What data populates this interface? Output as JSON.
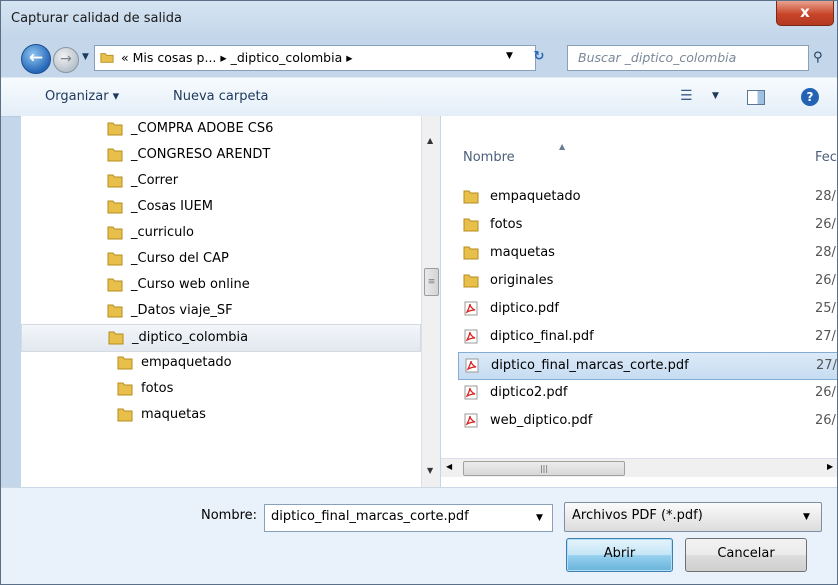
{
  "window": {
    "title": "Capturar calidad de salida",
    "close_symbol": "x"
  },
  "address": {
    "path": "« Mis cosas p... ▸ _diptico_colombia ▸",
    "search_placeholder": "Buscar _diptico_colombia"
  },
  "toolbar": {
    "organize_label": "Organizar ▾",
    "new_folder_label": "Nueva carpeta"
  },
  "nav_tree": [
    {
      "label": "_COMPRA ADOBE CS6"
    },
    {
      "label": "_CONGRESO ARENDT"
    },
    {
      "label": "_Correr"
    },
    {
      "label": "_Cosas IUEM"
    },
    {
      "label": "_curriculo"
    },
    {
      "label": "_Curso del CAP"
    },
    {
      "label": "_Curso web online"
    },
    {
      "label": "_Datos viaje_SF"
    },
    {
      "label": "_diptico_colombia",
      "selected": true
    },
    {
      "label": "empaquetado",
      "indent": true
    },
    {
      "label": "fotos",
      "indent": true
    },
    {
      "label": "maquetas",
      "indent": true
    }
  ],
  "file_list": {
    "columns": {
      "name": "Nombre",
      "date": "Fec"
    },
    "items": [
      {
        "name": "empaquetado",
        "type": "folder",
        "date": "28/"
      },
      {
        "name": "fotos",
        "type": "folder",
        "date": "26/"
      },
      {
        "name": "maquetas",
        "type": "folder",
        "date": "28/"
      },
      {
        "name": "originales",
        "type": "folder",
        "date": "26/"
      },
      {
        "name": "diptico.pdf",
        "type": "pdf",
        "date": "25/"
      },
      {
        "name": "diptico_final.pdf",
        "type": "pdf",
        "date": "27/"
      },
      {
        "name": "diptico_final_marcas_corte.pdf",
        "type": "pdf",
        "date": "27/",
        "selected": true
      },
      {
        "name": "diptico2.pdf",
        "type": "pdf",
        "date": "26/"
      },
      {
        "name": "web_diptico.pdf",
        "type": "pdf",
        "date": "26/"
      }
    ]
  },
  "footer": {
    "name_label": "Nombre:",
    "name_value": "diptico_final_marcas_corte.pdf",
    "file_type": "Archivos PDF (*.pdf)",
    "open_label": "Abrir",
    "cancel_label": "Cancelar"
  }
}
